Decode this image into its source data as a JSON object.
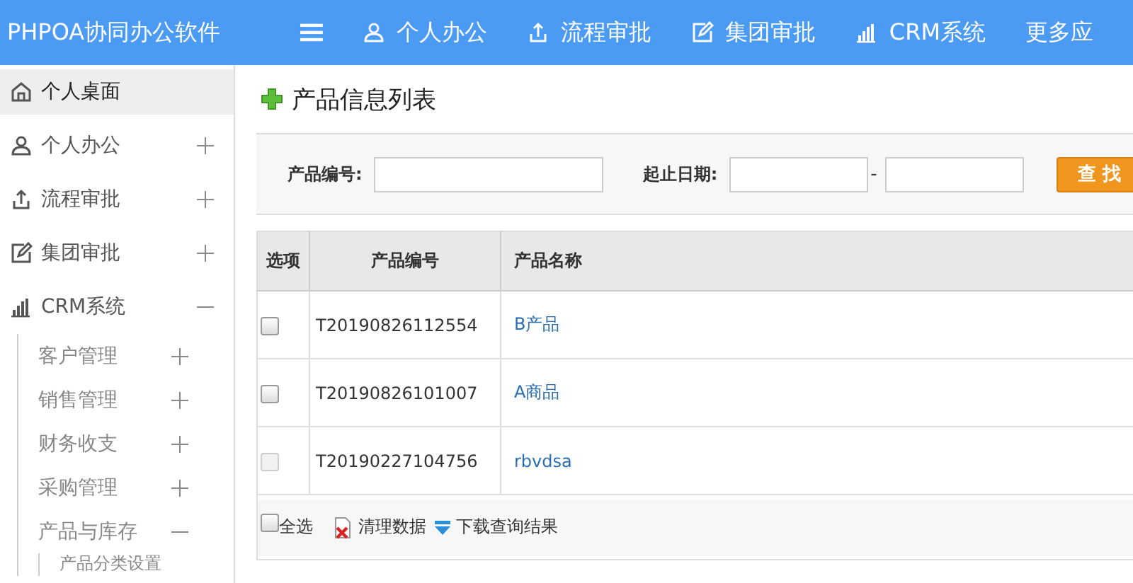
{
  "app": {
    "title": "PHPOA协同办公软件"
  },
  "top_nav": [
    {
      "label": "个人办公",
      "kind": "user"
    },
    {
      "label": "流程审批",
      "kind": "flow"
    },
    {
      "label": "集团审批",
      "kind": "edit"
    },
    {
      "label": "CRM系统",
      "kind": "chart"
    },
    {
      "label": "更多应",
      "kind": "more"
    }
  ],
  "sidebar": {
    "items": [
      {
        "label": "个人桌面",
        "kind": "home",
        "selected": true
      },
      {
        "label": "个人办公",
        "kind": "user",
        "selected": false,
        "expanded": false
      },
      {
        "label": "流程审批",
        "kind": "flow",
        "selected": false,
        "expanded": false
      },
      {
        "label": "集团审批",
        "kind": "edit",
        "selected": false,
        "expanded": false
      },
      {
        "label": "CRM系统",
        "kind": "chart",
        "selected": false,
        "expanded": true,
        "children": [
          {
            "label": "客户管理",
            "expanded": false
          },
          {
            "label": "销售管理",
            "expanded": false
          },
          {
            "label": "财务收支",
            "expanded": false
          },
          {
            "label": "采购管理",
            "expanded": false
          },
          {
            "label": "产品与库存",
            "expanded": true,
            "children": [
              {
                "label": "产品分类设置"
              }
            ]
          }
        ]
      }
    ]
  },
  "page": {
    "title": "产品信息列表"
  },
  "search": {
    "code_label": "产品编号:",
    "date_label": "起止日期:",
    "date_separator": "-",
    "button": "查 找"
  },
  "table": {
    "columns": [
      "选项",
      "产品编号",
      "产品名称"
    ],
    "rows": [
      {
        "checked": false,
        "disabled": false,
        "code": "T20190826112554",
        "name": "B产品"
      },
      {
        "checked": false,
        "disabled": false,
        "code": "T20190826101007",
        "name": "A商品"
      },
      {
        "checked": false,
        "disabled": true,
        "code": "T20190227104756",
        "name": "rbvdsa"
      }
    ],
    "footer": {
      "select_all": {
        "label": "全选",
        "checked": false
      },
      "actions": [
        {
          "label": "清理数据",
          "kind": "clear"
        },
        {
          "label": "下载查询结果",
          "kind": "download"
        }
      ]
    }
  }
}
